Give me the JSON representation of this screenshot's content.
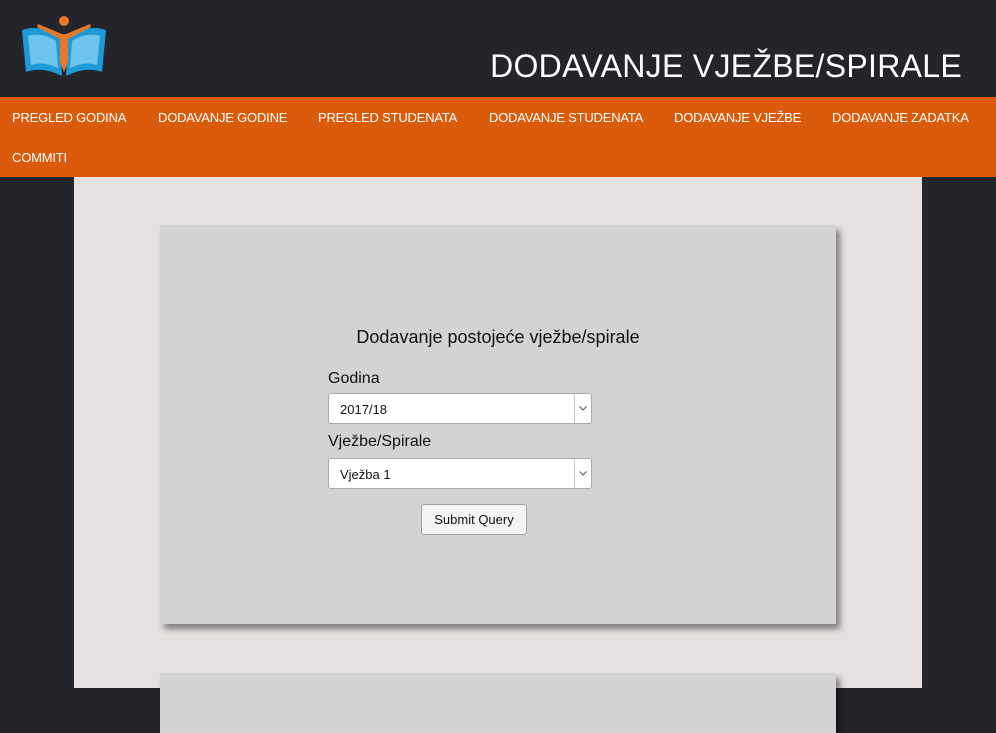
{
  "header": {
    "title": "DODAVANJE VJEŽBE/SPIRALE",
    "logo_icon": "book-person-logo-icon"
  },
  "nav": {
    "items": [
      {
        "label": "PREGLED GODINA"
      },
      {
        "label": "DODAVANJE GODINE"
      },
      {
        "label": "PREGLED STUDENATA"
      },
      {
        "label": "DODAVANJE STUDENATA"
      },
      {
        "label": "DODAVANJE VJEŽBE"
      },
      {
        "label": "DODAVANJE ZADATKA"
      },
      {
        "label": "COMMITI"
      }
    ]
  },
  "form": {
    "title": "Dodavanje postojeće vježbe/spirale",
    "godina_label": "Godina",
    "godina_value": "2017/18",
    "vjezba_label": "Vježbe/Spirale",
    "vjezba_value": "Vježba 1",
    "submit_label": "Submit Query"
  },
  "colors": {
    "background": "#23252b",
    "nav": "#d95b0b",
    "content": "#e6e1e0",
    "card": "#d3d3d3",
    "logo_blue": "#1e9ad6",
    "logo_orange": "#e8762b"
  }
}
